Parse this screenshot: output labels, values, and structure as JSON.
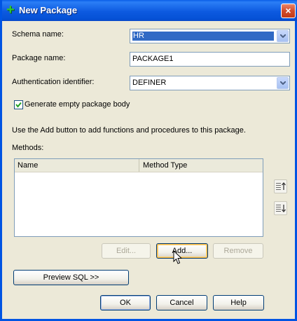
{
  "window": {
    "title": "New Package",
    "close_glyph": "×"
  },
  "form": {
    "schema_label": "Schema name:",
    "schema_value": "HR",
    "package_label": "Package name:",
    "package_value": "PACKAGE1",
    "auth_label": "Authentication identifier:",
    "auth_value": "DEFINER",
    "generate_checkbox_label": "Generate empty package body",
    "generate_checked": true,
    "hint": "Use the Add button to add functions and procedures to this package.",
    "methods_label": "Methods:"
  },
  "methods_table": {
    "columns": [
      "Name",
      "Method Type"
    ],
    "rows": []
  },
  "buttons": {
    "edit": "Edit...",
    "add": "Add...",
    "remove": "Remove",
    "preview": "Preview SQL >>",
    "ok": "OK",
    "cancel": "Cancel",
    "help": "Help"
  },
  "icons": {
    "title": "new-package-plus-icon",
    "move_up": "move-up-icon",
    "move_down": "move-down-icon",
    "cursor": "mouse-pointer-icon"
  },
  "colors": {
    "titlebar": "#0a5fe8",
    "selection": "#316ac5",
    "dialog_bg": "#ece9d8"
  }
}
